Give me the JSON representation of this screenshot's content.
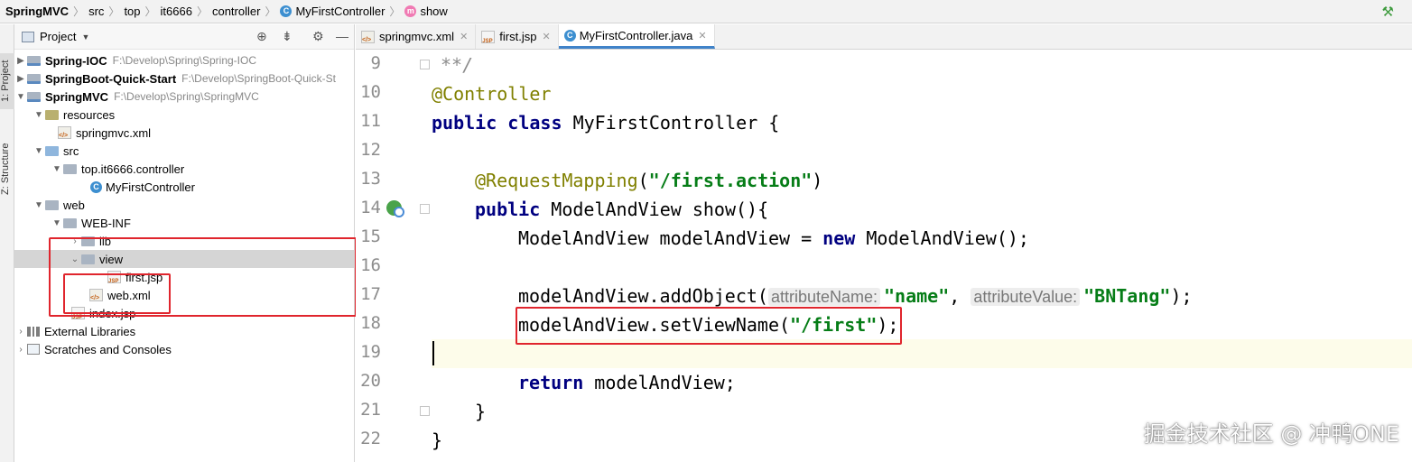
{
  "breadcrumb": {
    "items": [
      "SpringMVC",
      "src",
      "top",
      "it6666",
      "controller",
      "MyFirstController",
      "show"
    ],
    "class_icon_letter": "C",
    "method_icon_letter": "m"
  },
  "tool_strip": {
    "project_tab": "1: Project",
    "structure_tab": "Z: Structure"
  },
  "project_panel": {
    "title": "Project",
    "tree": [
      {
        "label": "Spring-IOC",
        "path": "F:\\Develop\\Spring\\Spring-IOC",
        "icon": "module-icon"
      },
      {
        "label": "SpringBoot-Quick-Start",
        "path": "F:\\Develop\\SpringBoot-Quick-St",
        "icon": "module-icon"
      },
      {
        "label": "SpringMVC",
        "path": "F:\\Develop\\Spring\\SpringMVC",
        "icon": "module-icon"
      },
      {
        "label": "resources",
        "icon": "resources-folder-icon"
      },
      {
        "label": "springmvc.xml",
        "icon": "xml-file-icon"
      },
      {
        "label": "src",
        "icon": "source-folder-icon"
      },
      {
        "label": "top.it6666.controller",
        "icon": "package-icon"
      },
      {
        "label": "MyFirstController",
        "icon": "class-icon"
      },
      {
        "label": "web",
        "icon": "folder-icon"
      },
      {
        "label": "WEB-INF",
        "icon": "folder-icon"
      },
      {
        "label": "lib",
        "icon": "folder-icon"
      },
      {
        "label": "view",
        "icon": "folder-icon"
      },
      {
        "label": "first.jsp",
        "icon": "jsp-file-icon"
      },
      {
        "label": "web.xml",
        "icon": "xml-file-icon"
      },
      {
        "label": "index.jsp",
        "icon": "jsp-file-icon"
      },
      {
        "label": "External Libraries",
        "icon": "library-icon"
      },
      {
        "label": "Scratches and Consoles",
        "icon": "scratch-icon"
      }
    ]
  },
  "editor_tabs": [
    {
      "label": "springmvc.xml",
      "active": false
    },
    {
      "label": "first.jsp",
      "active": false
    },
    {
      "label": "MyFirstController.java",
      "active": true
    }
  ],
  "editor": {
    "line_numbers": [
      "9",
      "10",
      "11",
      "12",
      "13",
      "14",
      "15",
      "16",
      "17",
      "18",
      "19",
      "20",
      "21",
      "22"
    ],
    "code": {
      "l9": "**/",
      "l10_anno": "@Controller",
      "l11_kw1": "public",
      "l11_kw2": "class",
      "l11_rest": "MyFirstController {",
      "l13_anno": "@RequestMapping",
      "l13_open": "(",
      "l13_str": "\"/first.action\"",
      "l13_close": ")",
      "l14_kw": "public",
      "l14_rest": "ModelAndView show(){",
      "l15_a": "ModelAndView modelAndView = ",
      "l15_kw": "new",
      "l15_b": "ModelAndView();",
      "l17_a": "modelAndView.addObject(",
      "l17_hint1": "attributeName:",
      "l17_str1": "\"name\"",
      "l17_comma": ", ",
      "l17_hint2": "attributeValue:",
      "l17_str2": "\"BNTang\"",
      "l17_end": ");",
      "l18_a": "modelAndView.setViewName(",
      "l18_str": "\"/first\"",
      "l18_end": ");",
      "l20_kw": "return",
      "l20_rest": "modelAndView;",
      "l21": "}",
      "l22": "}"
    }
  },
  "watermark": "掘金技术社区 @ 冲鸭ONE",
  "colors": {
    "keyword": "#000080",
    "annotation": "#808000",
    "string": "#067d17",
    "highlight_box": "#e0252d",
    "current_line": "#fdfcea",
    "active_tab_underline": "#4083c9"
  }
}
